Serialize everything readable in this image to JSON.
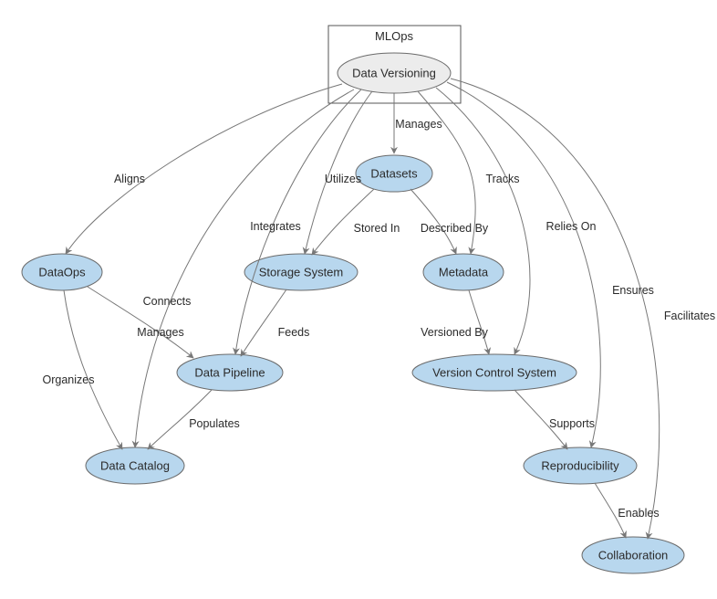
{
  "cluster": {
    "label": "MLOps"
  },
  "nodes": {
    "dataVersioning": "Data Versioning",
    "datasets": "Datasets",
    "dataops": "DataOps",
    "storageSystem": "Storage System",
    "metadata": "Metadata",
    "dataPipeline": "Data Pipeline",
    "versionControlSystem": "Version Control System",
    "dataCatalog": "Data Catalog",
    "reproducibility": "Reproducibility",
    "collaboration": "Collaboration"
  },
  "edges": {
    "aligns": "Aligns",
    "connects": "Connects",
    "manages_dv_ds": "Manages",
    "utilizes": "Utilizes",
    "integrates": "Integrates",
    "tracks": "Tracks",
    "reliesOn": "Relies On",
    "ensures": "Ensures",
    "facilitates": "Facilitates",
    "storedIn": "Stored In",
    "describedBy": "Described By",
    "manages_do_dp": "Manages",
    "organizes": "Organizes",
    "feeds": "Feeds",
    "versionedBy": "Versioned By",
    "populates": "Populates",
    "supports": "Supports",
    "enables": "Enables"
  },
  "chart_data": {
    "type": "graph",
    "directed": true,
    "clusters": [
      {
        "id": "mlops",
        "label": "MLOps",
        "members": [
          "Data Versioning"
        ]
      }
    ],
    "nodes": [
      {
        "id": "Data Versioning",
        "fill": "grey"
      },
      {
        "id": "Datasets"
      },
      {
        "id": "DataOps"
      },
      {
        "id": "Storage System"
      },
      {
        "id": "Metadata"
      },
      {
        "id": "Data Pipeline"
      },
      {
        "id": "Version Control System"
      },
      {
        "id": "Data Catalog"
      },
      {
        "id": "Reproducibility"
      },
      {
        "id": "Collaboration"
      }
    ],
    "edges": [
      {
        "from": "Data Versioning",
        "to": "DataOps",
        "label": "Aligns"
      },
      {
        "from": "Data Versioning",
        "to": "Data Catalog",
        "label": "Connects"
      },
      {
        "from": "Data Versioning",
        "to": "Datasets",
        "label": "Manages"
      },
      {
        "from": "Data Versioning",
        "to": "Storage System",
        "label": "Utilizes"
      },
      {
        "from": "Data Versioning",
        "to": "Data Pipeline",
        "label": "Integrates"
      },
      {
        "from": "Data Versioning",
        "to": "Metadata",
        "label": "Tracks"
      },
      {
        "from": "Data Versioning",
        "to": "Version Control System",
        "label": "Relies On"
      },
      {
        "from": "Data Versioning",
        "to": "Reproducibility",
        "label": "Ensures"
      },
      {
        "from": "Data Versioning",
        "to": "Collaboration",
        "label": "Facilitates"
      },
      {
        "from": "Datasets",
        "to": "Storage System",
        "label": "Stored In"
      },
      {
        "from": "Datasets",
        "to": "Metadata",
        "label": "Described By"
      },
      {
        "from": "DataOps",
        "to": "Data Pipeline",
        "label": "Manages"
      },
      {
        "from": "DataOps",
        "to": "Data Catalog",
        "label": "Organizes"
      },
      {
        "from": "Storage System",
        "to": "Data Pipeline",
        "label": "Feeds"
      },
      {
        "from": "Metadata",
        "to": "Version Control System",
        "label": "Versioned By"
      },
      {
        "from": "Data Pipeline",
        "to": "Data Catalog",
        "label": "Populates"
      },
      {
        "from": "Version Control System",
        "to": "Reproducibility",
        "label": "Supports"
      },
      {
        "from": "Reproducibility",
        "to": "Collaboration",
        "label": "Enables"
      }
    ]
  }
}
